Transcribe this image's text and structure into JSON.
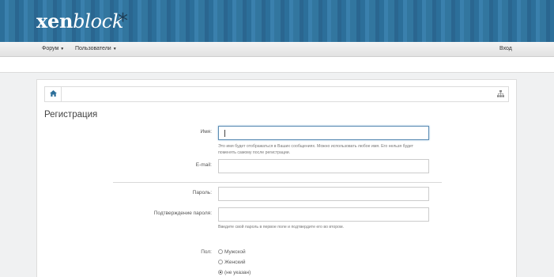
{
  "header": {
    "logo_part1": "xen",
    "logo_part2": "block",
    "logo_star": "*"
  },
  "nav": {
    "forum": "Форум",
    "users": "Пользователи",
    "login": "Вход"
  },
  "page": {
    "title": "Регистрация"
  },
  "form": {
    "name_label": "Имя:",
    "name_hint": "Это имя будет отображаться в Ваших сообщениях. Можно использовать любое имя. Его нельзя будет поменять самому после регистрации.",
    "email_label": "E-mail:",
    "password_label": "Пароль:",
    "password_confirm_label": "Подтверждение пароля:",
    "password_hint": "Введите свой пароль в первое поле и подтвердите его во втором.",
    "gender_label": "Пол:",
    "gender_options": [
      "Мужской",
      "Женский",
      "(не указан)"
    ],
    "gender_selected": "(не указан)"
  },
  "colors": {
    "header_blue": "#2c6f9a",
    "focus_border": "#5c8db4"
  }
}
